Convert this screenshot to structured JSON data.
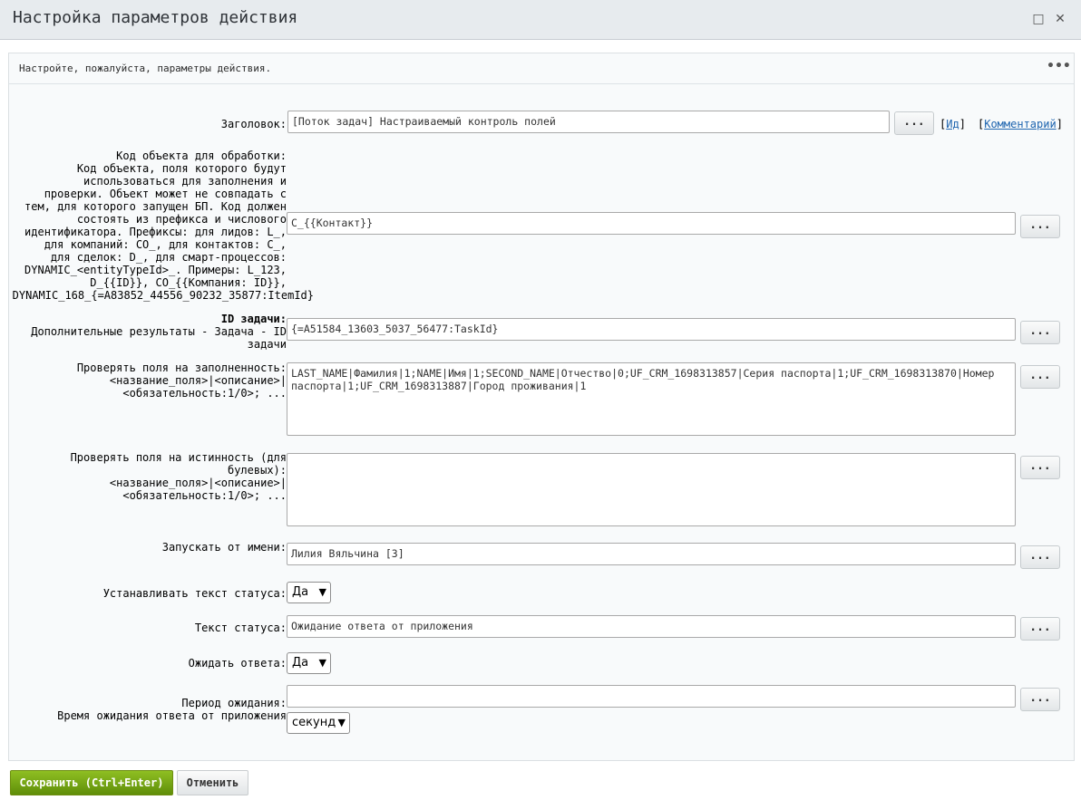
{
  "window": {
    "title": "Настройка параметров действия",
    "maximize_icon": "□",
    "close_icon": "✕"
  },
  "hint": {
    "text": "Настройте, пожалуйста, параметры действия.",
    "more_icon": "•••"
  },
  "fields": {
    "title": {
      "label": "Заголовок:",
      "value": "[Поток задач] Настраиваемый контроль полей",
      "id_link": "Ид",
      "comment_link": "Комментарий"
    },
    "object_code": {
      "label": "Код объекта для обработки:",
      "description": [
        "Код объекта, поля которого будут",
        "использоваться для заполнения и",
        "проверки. Объект может не совпадать с",
        "тем, для которого запущен БП. Код должен",
        "состоять из префикса и числового",
        "идентификатора. Префиксы: для лидов: L_,",
        "для компаний: CO_, для контактов: C_,",
        "для сделок: D_, для смарт-процессов:",
        "DYNAMIC_<entityTypeId>_. Примеры: L_123,",
        "D_{{ID}}, CO_{{Компания: ID}},",
        "DYNAMIC_168_{=A83852_44556_90232_35877:ItemId}"
      ],
      "value": "C_{{Контакт}}"
    },
    "task_id": {
      "label": "ID задачи:",
      "description": [
        "Дополнительные результаты - Задача - ID",
        "задачи"
      ],
      "value": "{=A51584_13603_5037_56477:TaskId}"
    },
    "check_filled": {
      "label_lines": [
        "Проверять поля на заполненность:",
        "<название_поля>|<описание>|",
        "<обязательность:1/0>; ..."
      ],
      "value": "LAST_NAME|Фамилия|1;NAME|Имя|1;SECOND_NAME|Отчество|0;UF_CRM_1698313857|Серия паспорта|1;UF_CRM_1698313870|Номер паспорта|1;UF_CRM_1698313887|Город проживания|1"
    },
    "check_true": {
      "label_lines": [
        "Проверять поля на истинность (для",
        "булевых):",
        "<название_поля>|<описание>|",
        "<обязательность:1/0>; ..."
      ],
      "value": ""
    },
    "run_as": {
      "label": "Запускать от имени:",
      "value": "Лилия Вяльчина [3]"
    },
    "set_status": {
      "label": "Устанавливать текст статуса:",
      "value": "Да"
    },
    "status_text": {
      "label": "Текст статуса:",
      "value": "Ожидание ответа от приложения"
    },
    "wait_answer": {
      "label": "Ожидать ответа:",
      "value": "Да"
    },
    "wait_period": {
      "label": "Период ожидания:",
      "description": "Время ожидания ответа от приложения",
      "value": "",
      "unit": "секунд"
    }
  },
  "buttons": {
    "dots_label": "...",
    "save": "Сохранить (Ctrl+Enter)",
    "cancel": "Отменить"
  }
}
